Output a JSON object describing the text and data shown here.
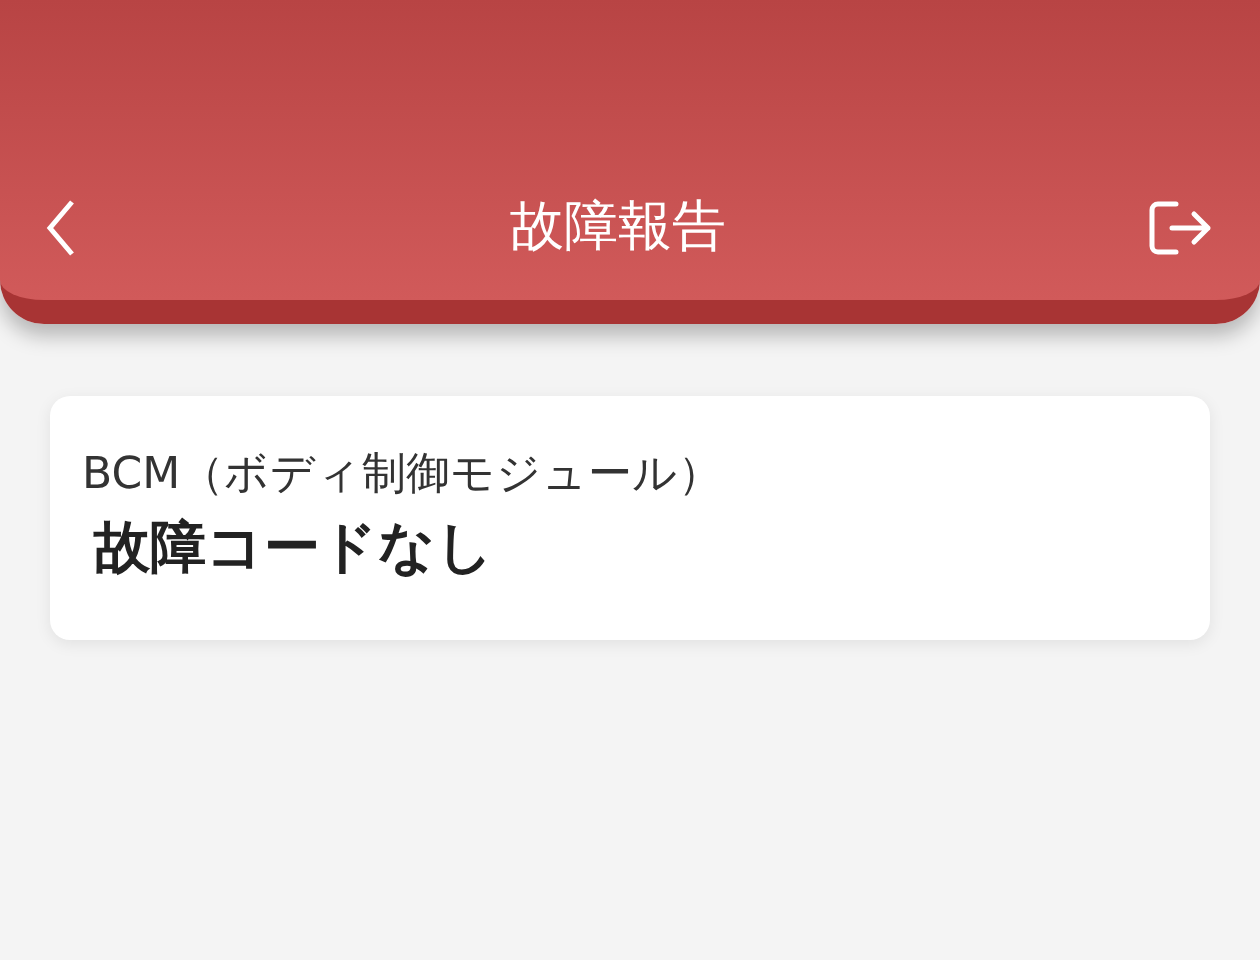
{
  "header": {
    "title": "故障報告"
  },
  "cards": [
    {
      "module": "BCM（ボディ制御モジュール）",
      "status": "故障コードなし"
    }
  ]
}
